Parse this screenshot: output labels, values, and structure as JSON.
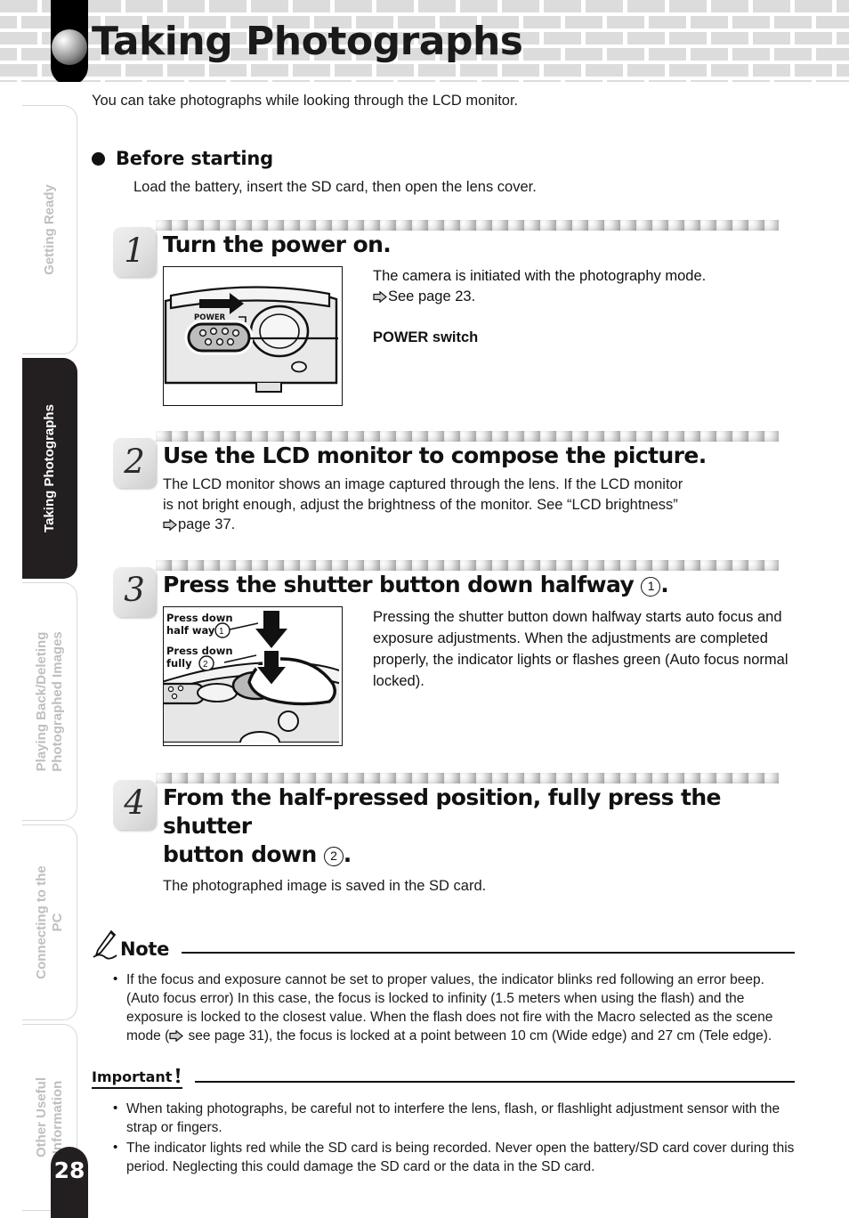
{
  "header": {
    "title": "Taking Photographs",
    "ball_icon": "sphere-bullet-icon"
  },
  "sidebar": {
    "items": [
      {
        "label": "Getting Ready",
        "active": false
      },
      {
        "label": "Taking Photographs",
        "active": true
      },
      {
        "label": "Playing Back/Deleting\nPhotographed Images",
        "active": false
      },
      {
        "label": "Connecting to the\nPC",
        "active": false
      },
      {
        "label": "Other Useful\nInformation",
        "active": false
      }
    ]
  },
  "page": {
    "number": "28",
    "intro": "You can take photographs while looking through the LCD monitor."
  },
  "before_starting": {
    "heading": "Before starting",
    "text": "Load the battery, insert the SD card, then open the lens cover."
  },
  "steps": [
    {
      "number": "1",
      "heading": "Turn the power on.",
      "body_line1": "The camera is initiated with the photography mode.",
      "body_line2": "See page 23.",
      "callout": "POWER switch",
      "figure_label": "POWER",
      "figure_name": "camera-top-power-switch-illustration"
    },
    {
      "number": "2",
      "heading": "Use the LCD monitor to compose the picture.",
      "body_line1": "The LCD monitor shows an image captured through the lens. If the LCD monitor",
      "body_line2": "is not bright enough, adjust the brightness of the monitor. See “LCD brightness”",
      "body_line3": "page 37."
    },
    {
      "number": "3",
      "heading_prefix": "Press the shutter button down halfway ",
      "heading_circle": "1",
      "heading_suffix": ".",
      "body": "Pressing the shutter button down halfway starts auto focus and exposure adjustments. When the adjustments are completed properly, the indicator lights or flashes green (Auto focus normal locked).",
      "figure_name": "shutter-button-press-illustration",
      "figure_labels": {
        "half_line1": "Press down",
        "half_line2": "half way",
        "half_circle": "1",
        "full_line1": "Press down",
        "full_line2": "fully",
        "full_circle": "2"
      }
    },
    {
      "number": "4",
      "heading_line1": "From the half-pressed position, fully press the shutter",
      "heading_line2_prefix": "button down ",
      "heading_circle": "2",
      "heading_line2_suffix": ".",
      "body": "The photographed image is saved in the SD card."
    }
  ],
  "note": {
    "title": "Note",
    "icon": "pen-icon",
    "bullets": [
      "If the focus and exposure cannot be set to proper values, the indicator blinks red following an error beep. (Auto focus error) In this case, the focus is locked to infinity (1.5 meters when using the flash) and the exposure is locked to the closest value. When the flash does not fire with the Macro selected as the scene mode (  see page 31), the focus is locked at a point between 10 cm (Wide edge) and 27 cm (Tele edge)."
    ],
    "bullet_part_a": "If the focus and exposure cannot be set to proper values, the indicator blinks red following an error beep. (Auto focus error) In this case, the focus is locked to infinity (1.5 meters when using the flash) and the exposure is locked to the closest value. When the flash does not fire with the Macro selected as the scene mode (",
    "bullet_part_b": " see page 31), the focus is locked at a point between 10 cm (Wide edge) and 27 cm (Tele edge)."
  },
  "important": {
    "title": "Important",
    "icon": "exclamation-icon",
    "bullets": [
      "When taking photographs, be careful not to interfere the lens, flash, or flashlight adjustment sensor with the strap or fingers.",
      "The indicator lights red while the SD card is being recorded. Never open the battery/SD card cover during this period. Neglecting this could damage the SD card or the data in the SD card."
    ]
  },
  "colors": {
    "brick": "#dcdcdc",
    "tab_active_bg": "#231f20",
    "tab_inactive_text": "#bfbfbf",
    "text": "#1a1a1a"
  }
}
